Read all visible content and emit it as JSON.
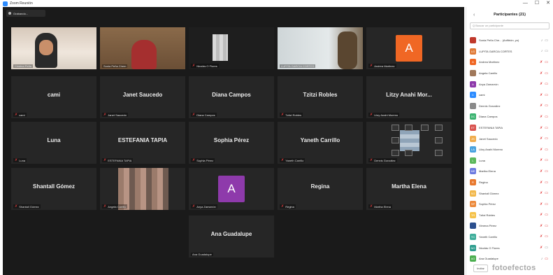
{
  "window": {
    "title": "Zoom Reunión",
    "controls": [
      "—",
      "☐",
      "✕"
    ]
  },
  "recording": {
    "label": "Grabando..."
  },
  "tiles": [
    {
      "id": "t1",
      "kind": "video",
      "display": "",
      "footer": "Cristina Peña",
      "muted": false
    },
    {
      "id": "t2",
      "kind": "video",
      "display": "",
      "footer": "Sonia Peña Chem",
      "muted": false
    },
    {
      "id": "t3",
      "kind": "video",
      "display": "",
      "footer": "Nicolás O Flores",
      "muted": true
    },
    {
      "id": "t4",
      "kind": "video",
      "display": "",
      "footer": "LUPITA GARCIA CORTES",
      "muted": false
    },
    {
      "id": "t5",
      "kind": "avatar",
      "display": "A",
      "footer": "Andrea Martinez",
      "muted": true,
      "color": "#f06724"
    },
    {
      "id": "t6",
      "kind": "name",
      "display": "cami",
      "footer": "cami",
      "muted": true
    },
    {
      "id": "t7",
      "kind": "name",
      "display": "Janet Saucedo",
      "footer": "Janet Saucedo",
      "muted": true
    },
    {
      "id": "t8",
      "kind": "name",
      "display": "Diana Campos",
      "footer": "Diana Campos",
      "muted": true
    },
    {
      "id": "t9",
      "kind": "name",
      "display": "Tzitzi Robles",
      "footer": "Tzitzi Robles",
      "muted": true
    },
    {
      "id": "t10",
      "kind": "name",
      "display": "Litzy Anahi Mor...",
      "footer": "Litzy Anahi Moreno",
      "muted": true
    },
    {
      "id": "t11",
      "kind": "name",
      "display": "Luna",
      "footer": "Luna",
      "muted": true
    },
    {
      "id": "t12",
      "kind": "name",
      "display": "ESTEFANIA TAPIA",
      "footer": "ESTEFANIA TAPIA",
      "muted": true
    },
    {
      "id": "t13",
      "kind": "name",
      "display": "Sophia Pérez",
      "footer": "Sophia Pérez",
      "muted": true
    },
    {
      "id": "t14",
      "kind": "name",
      "display": "Yaneth Carrillo",
      "footer": "Yaneth Carrillo",
      "muted": true
    },
    {
      "id": "t15",
      "kind": "video",
      "display": "",
      "footer": "Dennis González",
      "muted": true
    },
    {
      "id": "t16",
      "kind": "name",
      "display": "Shantall Gómez",
      "footer": "Shantall Gómez",
      "muted": true
    },
    {
      "id": "t17",
      "kind": "video",
      "display": "",
      "footer": "Angela Carrillo",
      "muted": true
    },
    {
      "id": "t18",
      "kind": "avatar",
      "display": "A",
      "footer": "Anya Zamarrón",
      "muted": true,
      "color": "#8e3aab"
    },
    {
      "id": "t19",
      "kind": "name",
      "display": "Regina",
      "footer": "Regina",
      "muted": true
    },
    {
      "id": "t20",
      "kind": "name",
      "display": "Martha Elena",
      "footer": "Martha Elena",
      "muted": true
    },
    {
      "id": "t21",
      "kind": "name",
      "display": "Ana Guadalupe",
      "footer": "Ana Guadalupe",
      "muted": false
    }
  ],
  "panel": {
    "title": "Participantes (21)",
    "search_placeholder": "Q Buscar un participante",
    "participants": [
      {
        "name": "Sonia Peña Che... (Anfitrión, yo)",
        "init": "",
        "color": "#c0392b",
        "muted": false,
        "cam_off": false
      },
      {
        "name": "LUPITA GARCIA CORTES",
        "init": "LG",
        "color": "#e07b39",
        "muted": false,
        "cam_off": false
      },
      {
        "name": "Andrea Martinez",
        "init": "A",
        "color": "#f06724",
        "muted": true,
        "cam_off": true
      },
      {
        "name": "Angela Carrillo",
        "init": "",
        "color": "#a0785a",
        "muted": true,
        "cam_off": true
      },
      {
        "name": "Anya Zamarrón",
        "init": "A",
        "color": "#8e3aab",
        "muted": true,
        "cam_off": true
      },
      {
        "name": "cami",
        "init": "C",
        "color": "#2d8cff",
        "muted": true,
        "cam_off": true
      },
      {
        "name": "Dennis González",
        "init": "",
        "color": "#8a8a8a",
        "muted": true,
        "cam_off": true
      },
      {
        "name": "Diana Campos",
        "init": "DC",
        "color": "#3cb371",
        "muted": true,
        "cam_off": true
      },
      {
        "name": "ESTEFANIA TAPIA",
        "init": "ET",
        "color": "#d9534f",
        "muted": true,
        "cam_off": true
      },
      {
        "name": "Janet Saucedo",
        "init": "JS",
        "color": "#f0ad4e",
        "muted": true,
        "cam_off": true
      },
      {
        "name": "Litzy Anahi Moreno",
        "init": "LA",
        "color": "#4aa3df",
        "muted": true,
        "cam_off": true
      },
      {
        "name": "Luna",
        "init": "L",
        "color": "#5cb85c",
        "muted": true,
        "cam_off": true
      },
      {
        "name": "Martha Elena",
        "init": "ME",
        "color": "#6c7ae0",
        "muted": true,
        "cam_off": true
      },
      {
        "name": "Regina",
        "init": "R",
        "color": "#e8792f",
        "muted": true,
        "cam_off": true
      },
      {
        "name": "Shantall Gómez",
        "init": "SG",
        "color": "#f2b84b",
        "muted": true,
        "cam_off": true
      },
      {
        "name": "Sophia Pérez",
        "init": "SP",
        "color": "#ec8a3c",
        "muted": true,
        "cam_off": true
      },
      {
        "name": "Tzitzi Robles",
        "init": "TR",
        "color": "#f5c24a",
        "muted": true,
        "cam_off": true
      },
      {
        "name": "Ximena Pérez",
        "init": "",
        "color": "#2b4f8e",
        "muted": true,
        "cam_off": true
      },
      {
        "name": "Yaneth Carrillo",
        "init": "YC",
        "color": "#3fae9b",
        "muted": true,
        "cam_off": true
      },
      {
        "name": "Nicolás O Flores",
        "init": "NO",
        "color": "#2f9e8f",
        "muted": true,
        "cam_off": false
      },
      {
        "name": "Ana Guadalupe",
        "init": "AG",
        "color": "#4caf50",
        "muted": false,
        "cam_off": true
      }
    ],
    "invite_label": "Invitar",
    "watermark": "fotoefectos"
  }
}
